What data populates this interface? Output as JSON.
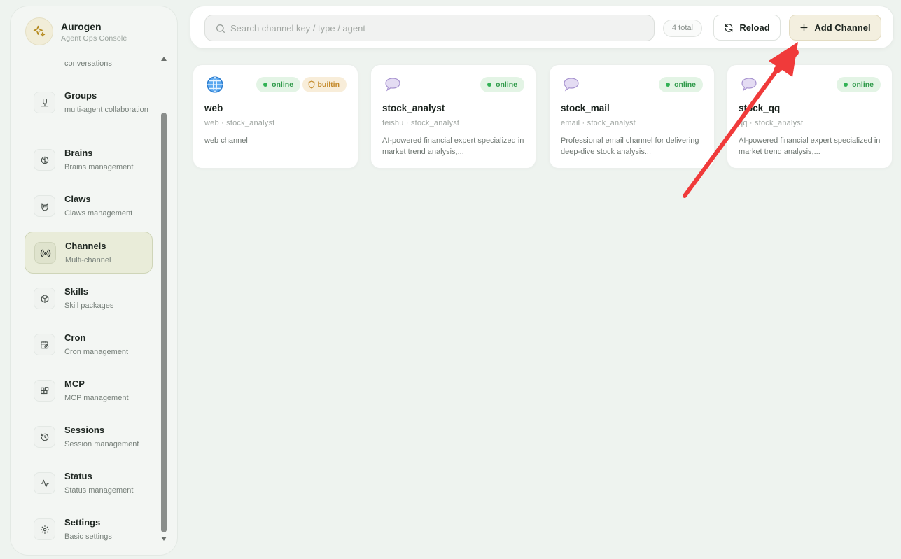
{
  "brand": {
    "title": "Aurogen",
    "subtitle": "Agent Ops Console"
  },
  "sidebar": {
    "items": [
      {
        "label": "",
        "desc": "conversations",
        "icon": "chat-icon"
      },
      {
        "label": "Groups",
        "desc": "multi-agent collaboration",
        "icon": "groups-icon"
      },
      {
        "label": "Brains",
        "desc": "Brains management",
        "icon": "brain-icon"
      },
      {
        "label": "Claws",
        "desc": "Claws management",
        "icon": "cat-icon"
      },
      {
        "label": "Channels",
        "desc": "Multi-channel",
        "icon": "broadcast-icon",
        "active": true
      },
      {
        "label": "Skills",
        "desc": "Skill packages",
        "icon": "package-icon"
      },
      {
        "label": "Cron",
        "desc": "Cron management",
        "icon": "calendar-clock-icon"
      },
      {
        "label": "MCP",
        "desc": "MCP management",
        "icon": "blocks-icon"
      },
      {
        "label": "Sessions",
        "desc": "Session management",
        "icon": "history-icon"
      },
      {
        "label": "Status",
        "desc": "Status management",
        "icon": "pulse-icon"
      },
      {
        "label": "Settings",
        "desc": "Basic settings",
        "icon": "gear-icon"
      }
    ]
  },
  "toolbar": {
    "search_placeholder": "Search channel key / type / agent",
    "count": "4 total",
    "reload_label": "Reload",
    "add_label": "Add Channel"
  },
  "channels": [
    {
      "name": "web",
      "meta": "web · stock_analyst",
      "desc": "web channel",
      "status": "online",
      "builtin": "builtin",
      "icon": "globe-icon"
    },
    {
      "name": "stock_analyst",
      "meta": "feishu · stock_analyst",
      "desc": "AI-powered financial expert specialized in market trend analysis,...",
      "status": "online",
      "icon": "speech-bubble-icon"
    },
    {
      "name": "stock_mail",
      "meta": "email · stock_analyst",
      "desc": "Professional email channel for delivering deep-dive stock analysis...",
      "status": "online",
      "icon": "speech-bubble-icon"
    },
    {
      "name": "stock_qq",
      "meta": "qq · stock_analyst",
      "desc": "AI-powered financial expert specialized in market trend analysis,...",
      "status": "online",
      "icon": "speech-bubble-icon"
    }
  ],
  "colors": {
    "accent": "#e9ecd9",
    "online": "#32b255",
    "builtin": "#c48a2b",
    "arrow": "#f03a3a"
  }
}
